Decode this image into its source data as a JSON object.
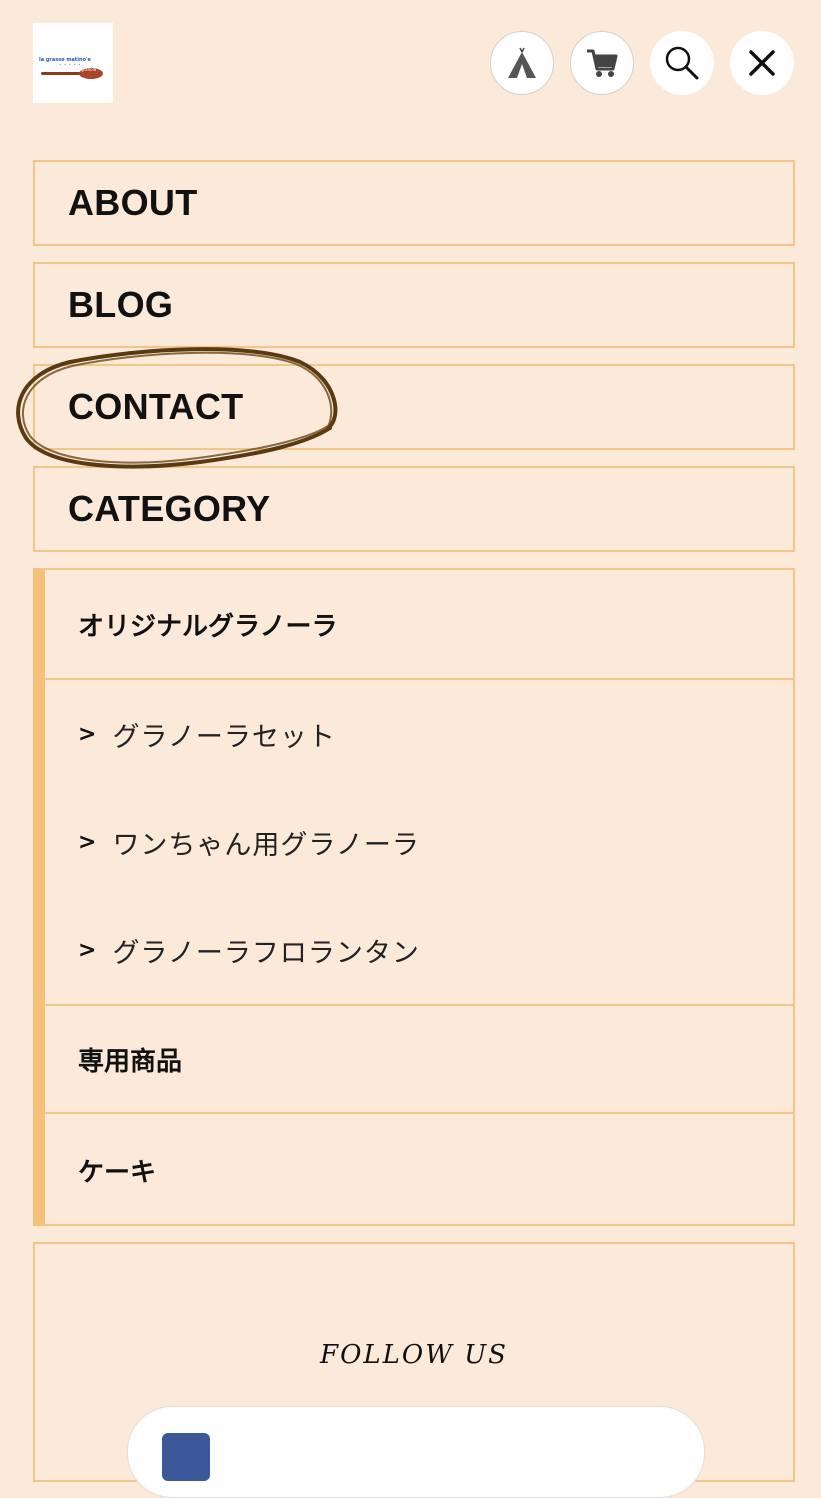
{
  "header": {
    "logo": {
      "text": "la grasse matino'e",
      "dots": "• • • • •",
      "badge": "granola"
    },
    "icons": [
      {
        "name": "tent-icon"
      },
      {
        "name": "cart-icon"
      },
      {
        "name": "search-icon"
      },
      {
        "name": "close-icon"
      }
    ]
  },
  "nav": {
    "about": "ABOUT",
    "blog": "BLOG",
    "contact": "CONTACT",
    "category": "CATEGORY"
  },
  "categories": {
    "parent": "オリジナルグラノーラ",
    "children": [
      {
        "arrow": ">",
        "label": "グラノーラセット"
      },
      {
        "arrow": ">",
        "label": "ワンちゃん用グラノーラ"
      },
      {
        "arrow": ">",
        "label": "グラノーラフロランタン"
      }
    ],
    "special": "専用商品",
    "cake": "ケーキ"
  },
  "follow": {
    "title": "FOLLOW US"
  },
  "colors": {
    "background": "#fbe9d9",
    "border": "#f1c688",
    "accent_bar": "#f4c07a",
    "annotation": "#5a3a10",
    "facebook": "#3b5998"
  }
}
